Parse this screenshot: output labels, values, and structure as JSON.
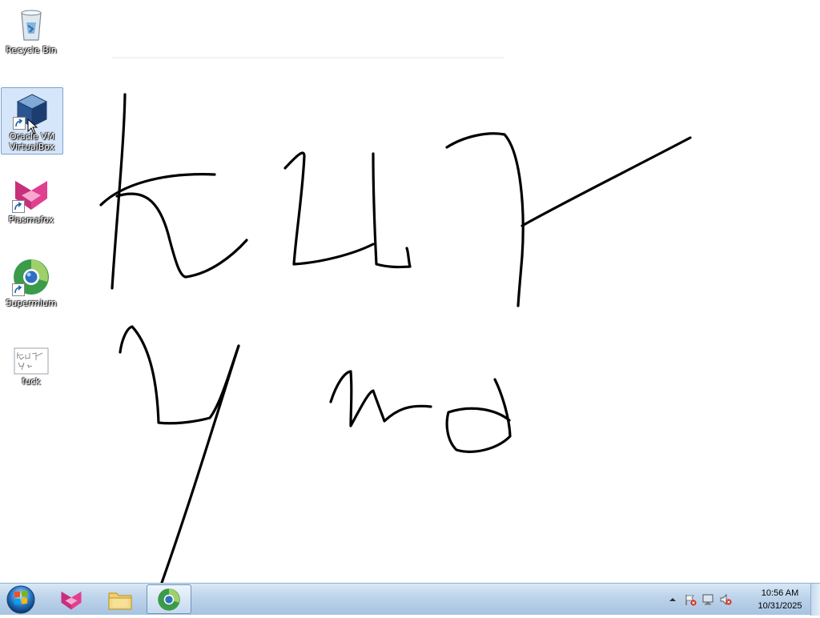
{
  "desktop": {
    "icons": [
      {
        "label": "Recycle Bin",
        "icon": "recycle-bin-icon"
      },
      {
        "label": "Oracle VM VirtualBox",
        "icon": "virtualbox-icon"
      },
      {
        "label": "Plasmafox",
        "icon": "plasmafox-icon"
      },
      {
        "label": "Supermium",
        "icon": "supermium-icon"
      },
      {
        "label": "fuck",
        "icon": "image-file-icon"
      }
    ]
  },
  "taskbar": {
    "pinned": [
      {
        "name": "Plasmafox",
        "icon": "plasmafox-icon"
      },
      {
        "name": "Windows Explorer",
        "icon": "folder-icon"
      },
      {
        "name": "Supermium",
        "icon": "supermium-icon"
      }
    ],
    "clock": {
      "time": "10:56 AM",
      "date": "10/31/2025"
    }
  },
  "colors": {
    "taskbar_top": "#d8e8f6",
    "taskbar_bottom": "#a7c3e0",
    "ink": "#000000"
  }
}
